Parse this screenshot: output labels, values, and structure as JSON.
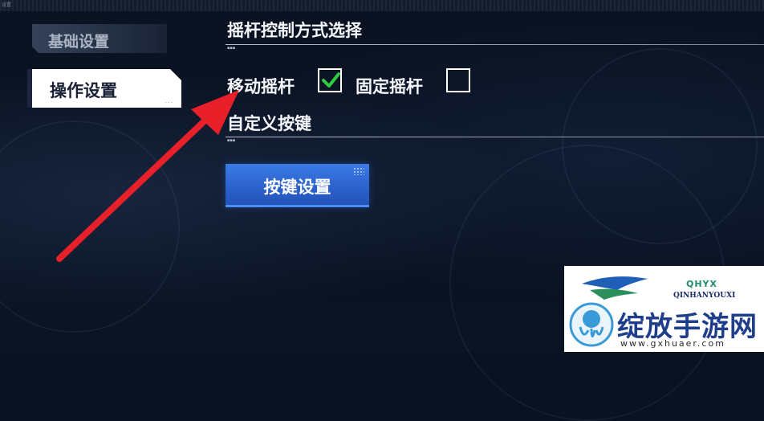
{
  "topbar": {
    "label": "设置"
  },
  "sidebar": {
    "items": [
      {
        "label": "基础设置",
        "active": false
      },
      {
        "label": "操作设置",
        "active": true
      }
    ]
  },
  "joystick_section": {
    "title": "摇杆控制方式选择",
    "options": [
      {
        "label": "移动摇杆",
        "checked": true
      },
      {
        "label": "固定摇杆",
        "checked": false
      }
    ]
  },
  "custom_keys_section": {
    "title": "自定义按键",
    "button_label": "按键设置"
  },
  "colors": {
    "accent_blue": "#2a5fc8",
    "check_green": "#2ecc40",
    "arrow_red": "#e8202a",
    "background": "#0a1120"
  },
  "watermark": {
    "brand": "QHYX",
    "sub": "QINHANYOUXI",
    "name": "绽放手游网",
    "url": "www.gxhuaer.com"
  }
}
